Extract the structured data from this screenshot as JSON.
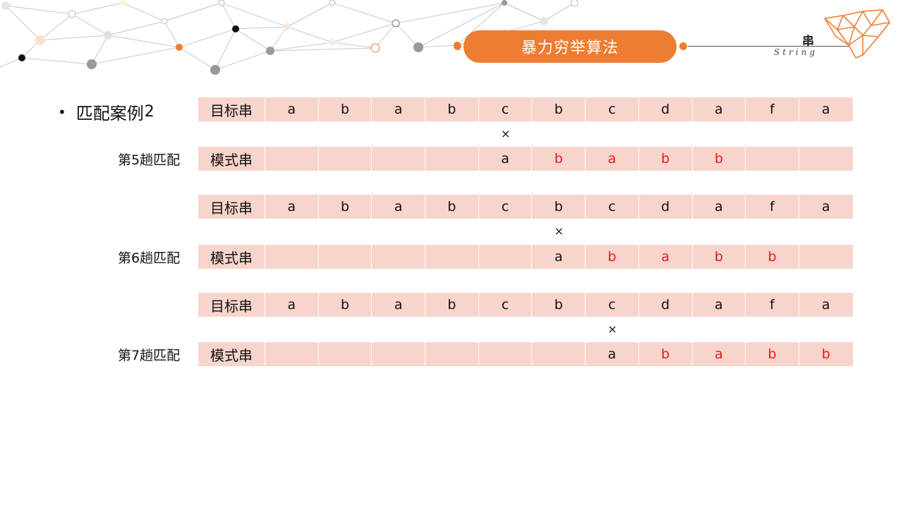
{
  "header": {
    "title": "暴力穷举算法",
    "section": "串",
    "section_sub": "String",
    "accent_color": "#ed7d31"
  },
  "bullet": {
    "text": "匹配案例",
    "number": "2"
  },
  "trials": [
    {
      "label": "第5趟匹配",
      "target": {
        "head": "目标串",
        "chars": [
          "a",
          "b",
          "a",
          "b",
          "c",
          "b",
          "c",
          "d",
          "a",
          "f",
          "a"
        ]
      },
      "mismatch_index": 4,
      "mismatch_mark": "×",
      "pattern": {
        "head": "模式串",
        "chars": [
          "",
          "",
          "",
          "",
          "a",
          "b",
          "a",
          "b",
          "b",
          "",
          ""
        ],
        "red": [
          5,
          6,
          7,
          8
        ]
      }
    },
    {
      "label": "第6趟匹配",
      "target": {
        "head": "目标串",
        "chars": [
          "a",
          "b",
          "a",
          "b",
          "c",
          "b",
          "c",
          "d",
          "a",
          "f",
          "a"
        ]
      },
      "mismatch_index": 5,
      "mismatch_mark": "×",
      "pattern": {
        "head": "模式串",
        "chars": [
          "",
          "",
          "",
          "",
          "",
          "a",
          "b",
          "a",
          "b",
          "b",
          ""
        ],
        "red": [
          6,
          7,
          8,
          9
        ]
      }
    },
    {
      "label": "第7趟匹配",
      "target": {
        "head": "目标串",
        "chars": [
          "a",
          "b",
          "a",
          "b",
          "c",
          "b",
          "c",
          "d",
          "a",
          "f",
          "a"
        ]
      },
      "mismatch_index": 6,
      "mismatch_mark": "×",
      "pattern": {
        "head": "模式串",
        "chars": [
          "",
          "",
          "",
          "",
          "",
          "",
          "a",
          "b",
          "a",
          "b",
          "b"
        ],
        "red": [
          7,
          8,
          9,
          10
        ]
      }
    }
  ],
  "colors": {
    "cell_bg": "#f8d5cc",
    "mismatch_char": "#e21b1b"
  }
}
